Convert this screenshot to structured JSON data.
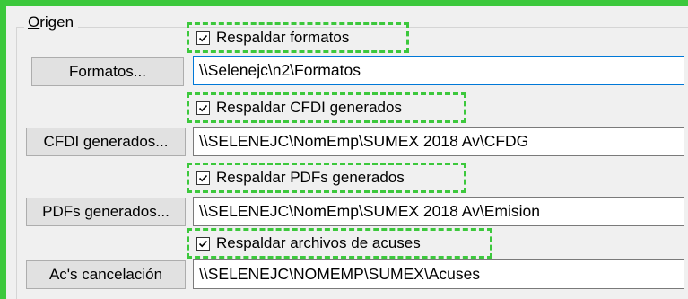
{
  "group": {
    "title_underlined": "O",
    "title_rest": "rigen"
  },
  "rows": [
    {
      "checkbox_label": "Respaldar formatos",
      "checked": true,
      "button_label": "Formatos...",
      "path": "\\\\Selenejc\\n2\\Formatos"
    },
    {
      "checkbox_label": "Respaldar CFDI generados",
      "checked": true,
      "button_label": "CFDI generados...",
      "path": "\\\\SELENEJC\\NomEmp\\SUMEX 2018 Av\\CFDG"
    },
    {
      "checkbox_label": "Respaldar PDFs generados",
      "checked": true,
      "button_label": "PDFs generados...",
      "path": "\\\\SELENEJC\\NomEmp\\SUMEX 2018 Av\\Emision"
    },
    {
      "checkbox_label": "Respaldar archivos de acuses",
      "checked": true,
      "button_label": "Ac's cancelación",
      "path": "\\\\SELENEJC\\NOMEMP\\SUMEX\\Acuses"
    }
  ],
  "colors": {
    "highlight": "#3cc83c",
    "focus_border": "#0078d7"
  }
}
